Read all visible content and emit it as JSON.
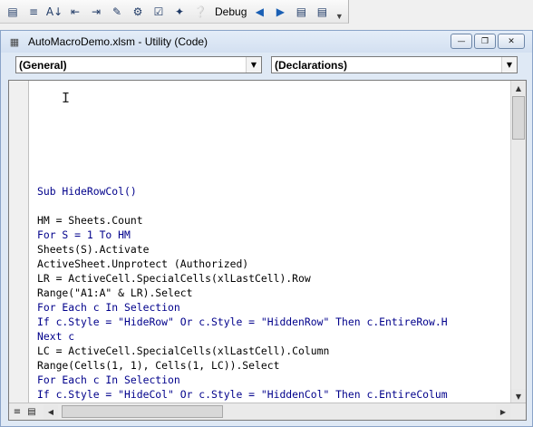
{
  "toolbar": {
    "debug_label": "Debug",
    "buttons": [
      "list-properties-icon",
      "list-constants-icon",
      "quick-info-icon",
      "parameter-info-icon",
      "complete-word-icon",
      "indent-icon",
      "outdent-icon",
      "toggle-breakpoint-icon",
      "comment-block-icon",
      "uncomment-block-icon",
      "bookmark-icon",
      "help-icon"
    ]
  },
  "window": {
    "title": "AutoMacroDemo.xlsm - Utility (Code)"
  },
  "object_combo": {
    "value": "(General)"
  },
  "procedure_combo": {
    "value": "(Declarations)"
  },
  "colors": {
    "keyword": "#00008b",
    "text": "#000000",
    "window_frame": "#dfe9f5"
  },
  "code_lines": [
    "Sub HideRowCol()",
    "",
    "HM = Sheets.Count",
    "For S = 1 To HM",
    "Sheets(S).Activate",
    "ActiveSheet.Unprotect (Authorized)",
    "LR = ActiveCell.SpecialCells(xlLastCell).Row",
    "Range(\"A1:A\" & LR).Select",
    "For Each c In Selection",
    "If c.Style = \"HideRow\" Or c.Style = \"HiddenRow\" Then c.EntireRow.H",
    "Next c",
    "LC = ActiveCell.SpecialCells(xlLastCell).Column",
    "Range(Cells(1, 1), Cells(1, LC)).Select",
    "For Each c In Selection",
    "If c.Style = \"HideCol\" Or c.Style = \"HiddenCol\" Then c.EntireColum"
  ]
}
